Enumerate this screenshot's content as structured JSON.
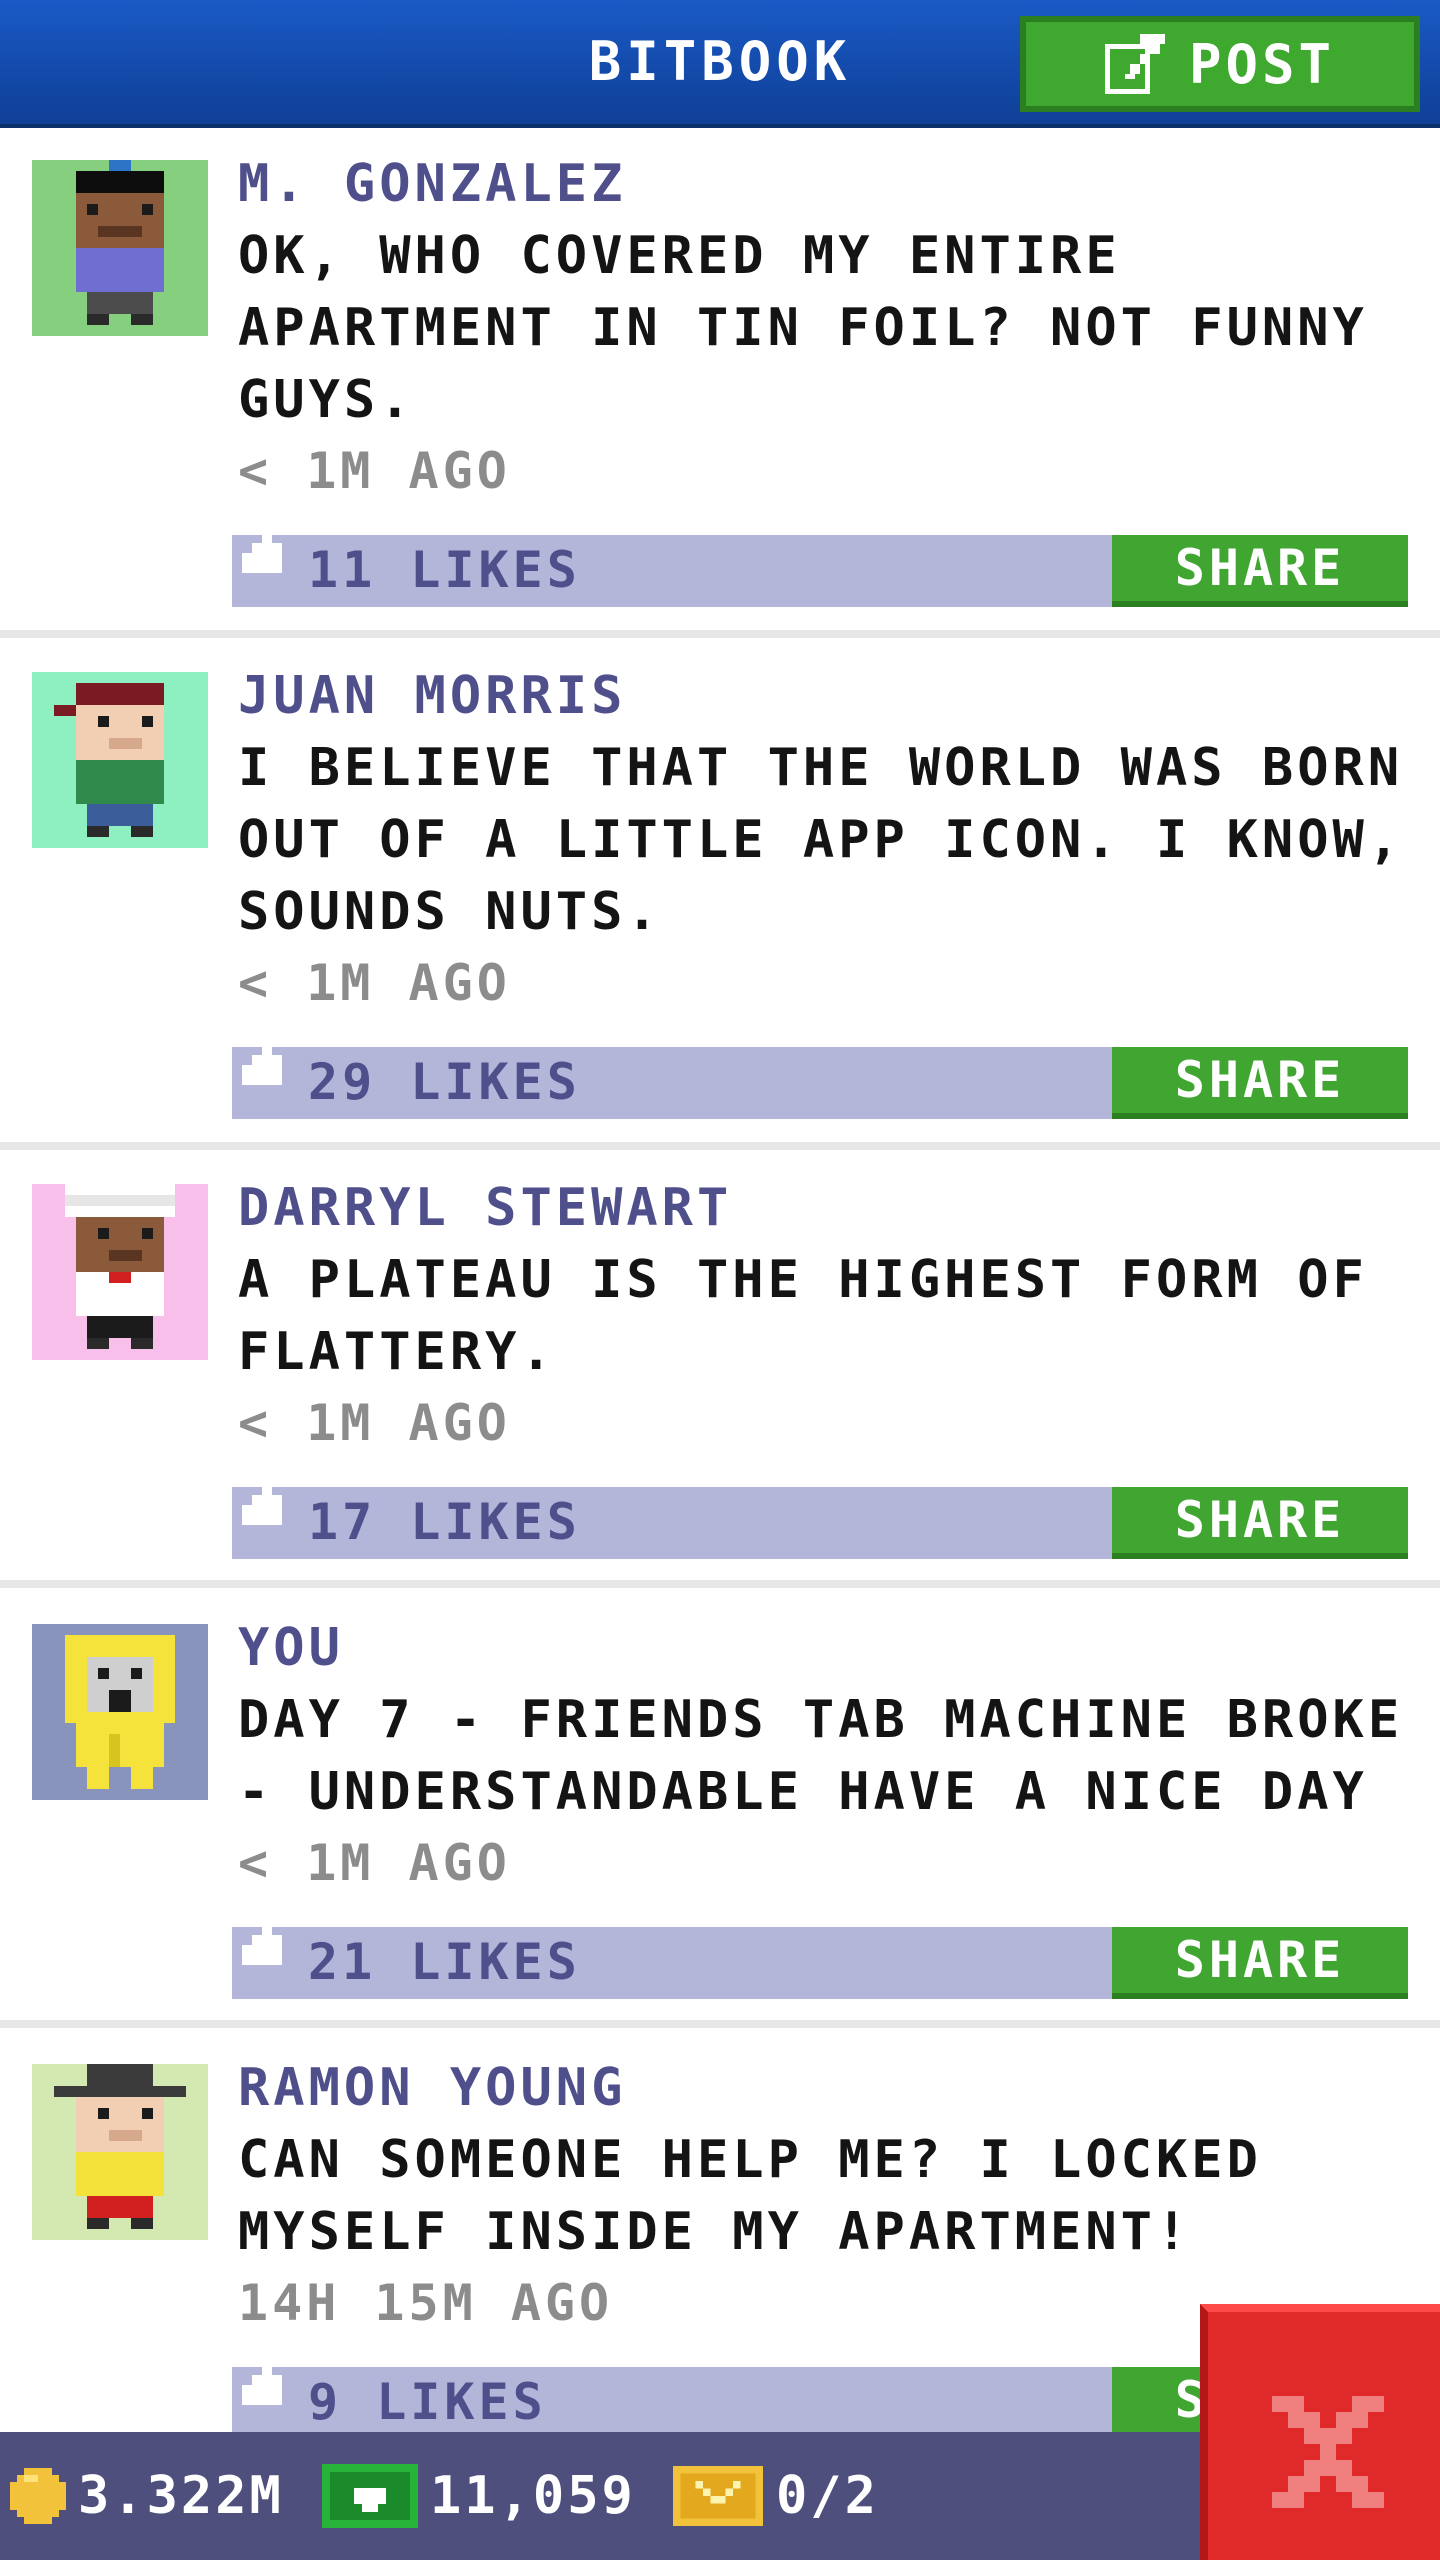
{
  "header": {
    "title": "BITBOOK",
    "post_label": "POST",
    "post_icon": "edit-icon",
    "color": "#1a5ac6"
  },
  "posts": [
    {
      "author": "M. GONZALEZ",
      "text": "OK, WHO COVERED MY ENTIRE APARTMENT IN TIN FOIL? NOT FUNNY GUYS.",
      "time": "< 1M AGO",
      "likes": "11 LIKES",
      "share_label": "SHARE",
      "avatar": "bitizen-avatar-beanie"
    },
    {
      "author": "JUAN MORRIS",
      "text": "I BELIEVE THAT THE WORLD WAS BORN OUT OF A LITTLE APP ICON. I KNOW, SOUNDS NUTS.",
      "time": "< 1M AGO",
      "likes": "29 LIKES",
      "share_label": "SHARE",
      "avatar": "bitizen-avatar-cap"
    },
    {
      "author": "DARRYL STEWART",
      "text": "A PLATEAU IS THE HIGHEST FORM OF FLATTERY.",
      "time": "< 1M AGO",
      "likes": "17 LIKES",
      "share_label": "SHARE",
      "avatar": "bitizen-avatar-chef"
    },
    {
      "author": "YOU",
      "text": "DAY 7 - FRIENDS TAB MACHINE BROKE - UNDERSTANDABLE HAVE A NICE DAY",
      "time": "< 1M AGO",
      "likes": "21 LIKES",
      "share_label": "SHARE",
      "avatar": "bitizen-avatar-raincoat"
    },
    {
      "author": "RAMON YOUNG",
      "text": "CAN SOMEONE HELP ME? I LOCKED MYSELF INSIDE MY APARTMENT!",
      "time": "14H 15M AGO",
      "likes": "9 LIKES",
      "share_label": "SHARE",
      "avatar": "bitizen-avatar-fedora"
    }
  ],
  "status_bar": {
    "coins": "3.322M",
    "bux": "11,059",
    "tickets": "0/2"
  },
  "close_icon": "close-x-icon"
}
